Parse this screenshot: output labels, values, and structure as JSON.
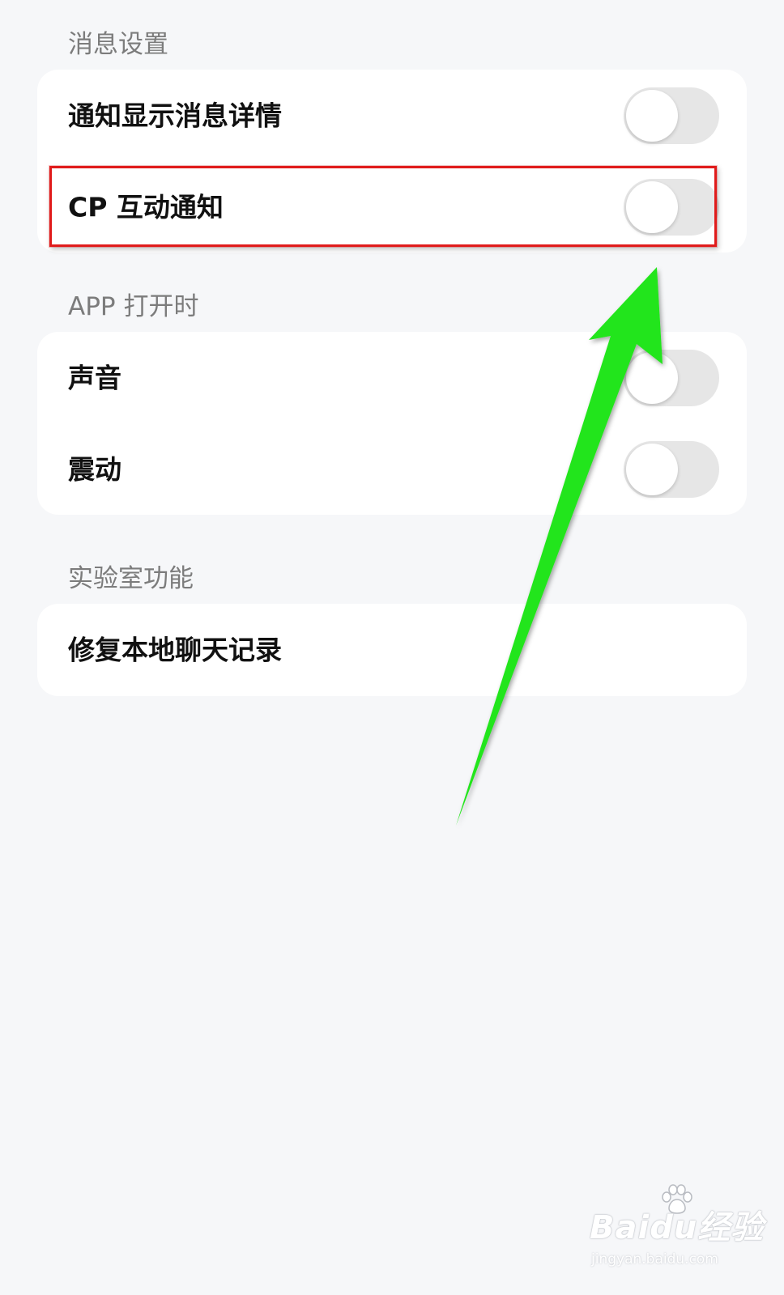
{
  "sections": [
    {
      "header": "消息设置",
      "items": [
        {
          "label": "通知显示消息详情",
          "toggle_on": false
        },
        {
          "label": "CP 互动通知",
          "toggle_on": false
        }
      ]
    },
    {
      "header": "APP 打开时",
      "items": [
        {
          "label": "声音",
          "toggle_on": false
        },
        {
          "label": "震动",
          "toggle_on": false
        }
      ]
    },
    {
      "header": "实验室功能",
      "items": [
        {
          "label": "修复本地聊天记录"
        }
      ]
    }
  ],
  "annotation": {
    "highlight_color": "#e01b1b",
    "arrow_color": "#22e51a"
  },
  "watermark": {
    "logo": "Baidu经验",
    "url": "jingyan.baidu.com"
  },
  "colors": {
    "background": "#f6f7f9",
    "card": "#ffffff",
    "toggle_off": "#e6e6e6"
  }
}
